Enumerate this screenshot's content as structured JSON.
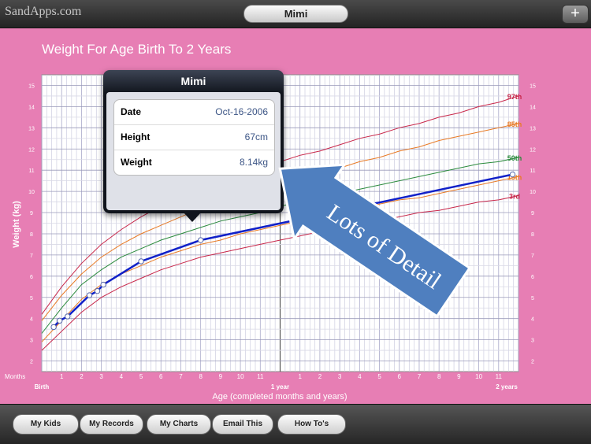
{
  "header": {
    "brand": "SandApps.com",
    "title": "Mimi",
    "add_label": "+"
  },
  "chart_title": "Weight For Age Birth To 2 Years",
  "popup": {
    "title": "Mimi",
    "rows": [
      {
        "label": "Date",
        "value": "Oct-16-2006"
      },
      {
        "label": "Height",
        "value": "67cm"
      },
      {
        "label": "Weight",
        "value": "8.14kg"
      }
    ]
  },
  "banner": "Lots of Detail",
  "tabs": [
    {
      "label": "My Kids"
    },
    {
      "label": "My Records"
    },
    {
      "label": "My Charts"
    },
    {
      "label": "Email This"
    },
    {
      "label": "How To's"
    }
  ],
  "chart_data": {
    "type": "line",
    "title": "Weight For Age Birth To 2 Years",
    "xlabel": "Age (completed months and years)",
    "ylabel": "Weight (kg)",
    "xlim": [
      0,
      24
    ],
    "ylim": [
      1.5,
      15.5
    ],
    "yticks": [
      2,
      3,
      4,
      5,
      6,
      7,
      8,
      9,
      10,
      11,
      12,
      13,
      14,
      15
    ],
    "xtick_labels": [
      {
        "x": 0,
        "label": "Birth"
      },
      {
        "x": 1,
        "label": "1"
      },
      {
        "x": 2,
        "label": "2"
      },
      {
        "x": 3,
        "label": "3"
      },
      {
        "x": 4,
        "label": "4"
      },
      {
        "x": 5,
        "label": "5"
      },
      {
        "x": 6,
        "label": "6"
      },
      {
        "x": 7,
        "label": "7"
      },
      {
        "x": 8,
        "label": "8"
      },
      {
        "x": 9,
        "label": "9"
      },
      {
        "x": 10,
        "label": "10"
      },
      {
        "x": 11,
        "label": "11"
      },
      {
        "x": 12,
        "label": "1 year"
      },
      {
        "x": 13,
        "label": "1"
      },
      {
        "x": 14,
        "label": "2"
      },
      {
        "x": 15,
        "label": "3"
      },
      {
        "x": 16,
        "label": "4"
      },
      {
        "x": 17,
        "label": "5"
      },
      {
        "x": 18,
        "label": "6"
      },
      {
        "x": 19,
        "label": "7"
      },
      {
        "x": 20,
        "label": "8"
      },
      {
        "x": 21,
        "label": "9"
      },
      {
        "x": 22,
        "label": "10"
      },
      {
        "x": 23,
        "label": "11"
      },
      {
        "x": 24,
        "label": "2 years"
      }
    ],
    "months_label": "Months",
    "x": [
      0,
      1,
      2,
      3,
      4,
      5,
      6,
      7,
      8,
      9,
      10,
      11,
      12,
      13,
      14,
      15,
      16,
      17,
      18,
      19,
      20,
      21,
      22,
      23,
      24
    ],
    "series": [
      {
        "name": "97th",
        "color": "#c8274a",
        "values": [
          4.2,
          5.5,
          6.6,
          7.5,
          8.2,
          8.8,
          9.3,
          9.7,
          10.1,
          10.5,
          10.8,
          11.1,
          11.4,
          11.7,
          11.9,
          12.2,
          12.5,
          12.7,
          13.0,
          13.2,
          13.5,
          13.7,
          14.0,
          14.2,
          14.5
        ]
      },
      {
        "name": "85th",
        "color": "#e87a25",
        "values": [
          3.9,
          5.1,
          6.1,
          6.9,
          7.5,
          8.0,
          8.4,
          8.8,
          9.2,
          9.5,
          9.8,
          10.1,
          10.4,
          10.6,
          10.9,
          11.1,
          11.4,
          11.6,
          11.9,
          12.1,
          12.4,
          12.6,
          12.8,
          13.0,
          13.2
        ]
      },
      {
        "name": "50th",
        "color": "#2a8a3c",
        "values": [
          3.3,
          4.5,
          5.6,
          6.3,
          6.9,
          7.3,
          7.7,
          8.0,
          8.3,
          8.6,
          8.8,
          9.0,
          9.3,
          9.5,
          9.7,
          9.9,
          10.1,
          10.3,
          10.5,
          10.7,
          10.9,
          11.1,
          11.3,
          11.4,
          11.6
        ]
      },
      {
        "name": "15th",
        "color": "#e87a25",
        "values": [
          2.9,
          3.9,
          4.9,
          5.6,
          6.1,
          6.5,
          6.9,
          7.2,
          7.5,
          7.7,
          8.0,
          8.2,
          8.4,
          8.6,
          8.8,
          9.0,
          9.2,
          9.4,
          9.6,
          9.7,
          9.9,
          10.1,
          10.3,
          10.5,
          10.7
        ]
      },
      {
        "name": "3rd",
        "color": "#c8274a",
        "values": [
          2.5,
          3.4,
          4.3,
          5.0,
          5.5,
          5.9,
          6.3,
          6.6,
          6.9,
          7.1,
          7.3,
          7.5,
          7.7,
          7.9,
          8.1,
          8.3,
          8.5,
          8.6,
          8.8,
          9.0,
          9.1,
          9.3,
          9.5,
          9.6,
          9.8
        ]
      }
    ],
    "child_series": {
      "name": "Mimi",
      "color": "#1020c8",
      "points": [
        [
          0.6,
          3.6
        ],
        [
          0.9,
          3.9
        ],
        [
          1.3,
          4.1
        ],
        [
          2.4,
          5.1
        ],
        [
          2.8,
          5.3
        ],
        [
          3.1,
          5.6
        ],
        [
          5.0,
          6.7
        ],
        [
          8.0,
          7.7
        ],
        [
          23.7,
          10.8
        ]
      ]
    }
  }
}
